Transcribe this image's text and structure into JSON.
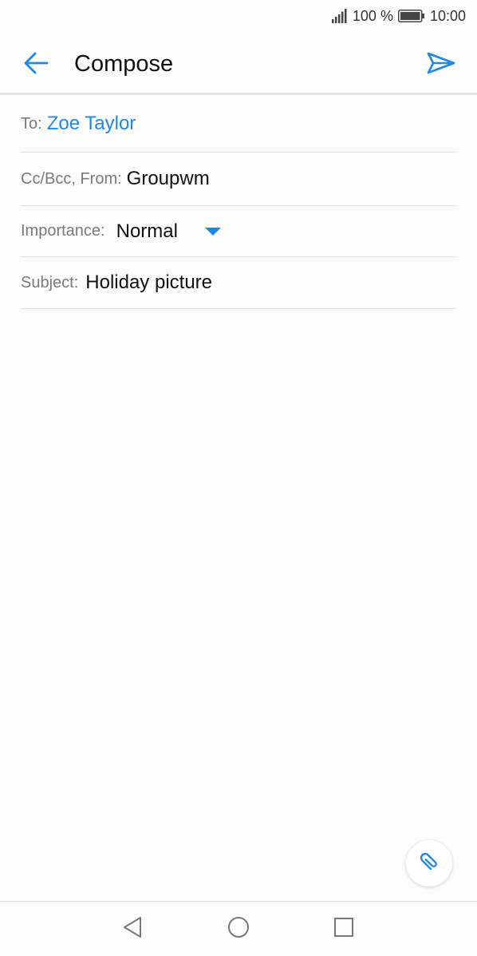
{
  "status_bar": {
    "battery_text": "100 %",
    "time": "10:00",
    "icons": [
      "signal-icon",
      "battery-icon"
    ]
  },
  "app_bar": {
    "title": "Compose",
    "back_icon": "arrow-back-icon",
    "send_icon": "send-icon"
  },
  "fields": {
    "to": {
      "label": "To:",
      "value": "Zoe Taylor"
    },
    "cc_bcc_from": {
      "label": "Cc/Bcc, From:",
      "value": "Groupwm"
    },
    "importance": {
      "label": "Importance:",
      "value": "Normal"
    },
    "subject": {
      "label": "Subject:",
      "value": "Holiday picture"
    }
  },
  "fab": {
    "icon": "paperclip-icon"
  },
  "nav_bar": {
    "icons": [
      "nav-back-icon",
      "nav-home-icon",
      "nav-recent-icon"
    ]
  },
  "colors": {
    "accent": "#1e88e5",
    "background": "#fcfcfc",
    "divider": "#e2e2e2",
    "label": "#7a7a7a"
  }
}
